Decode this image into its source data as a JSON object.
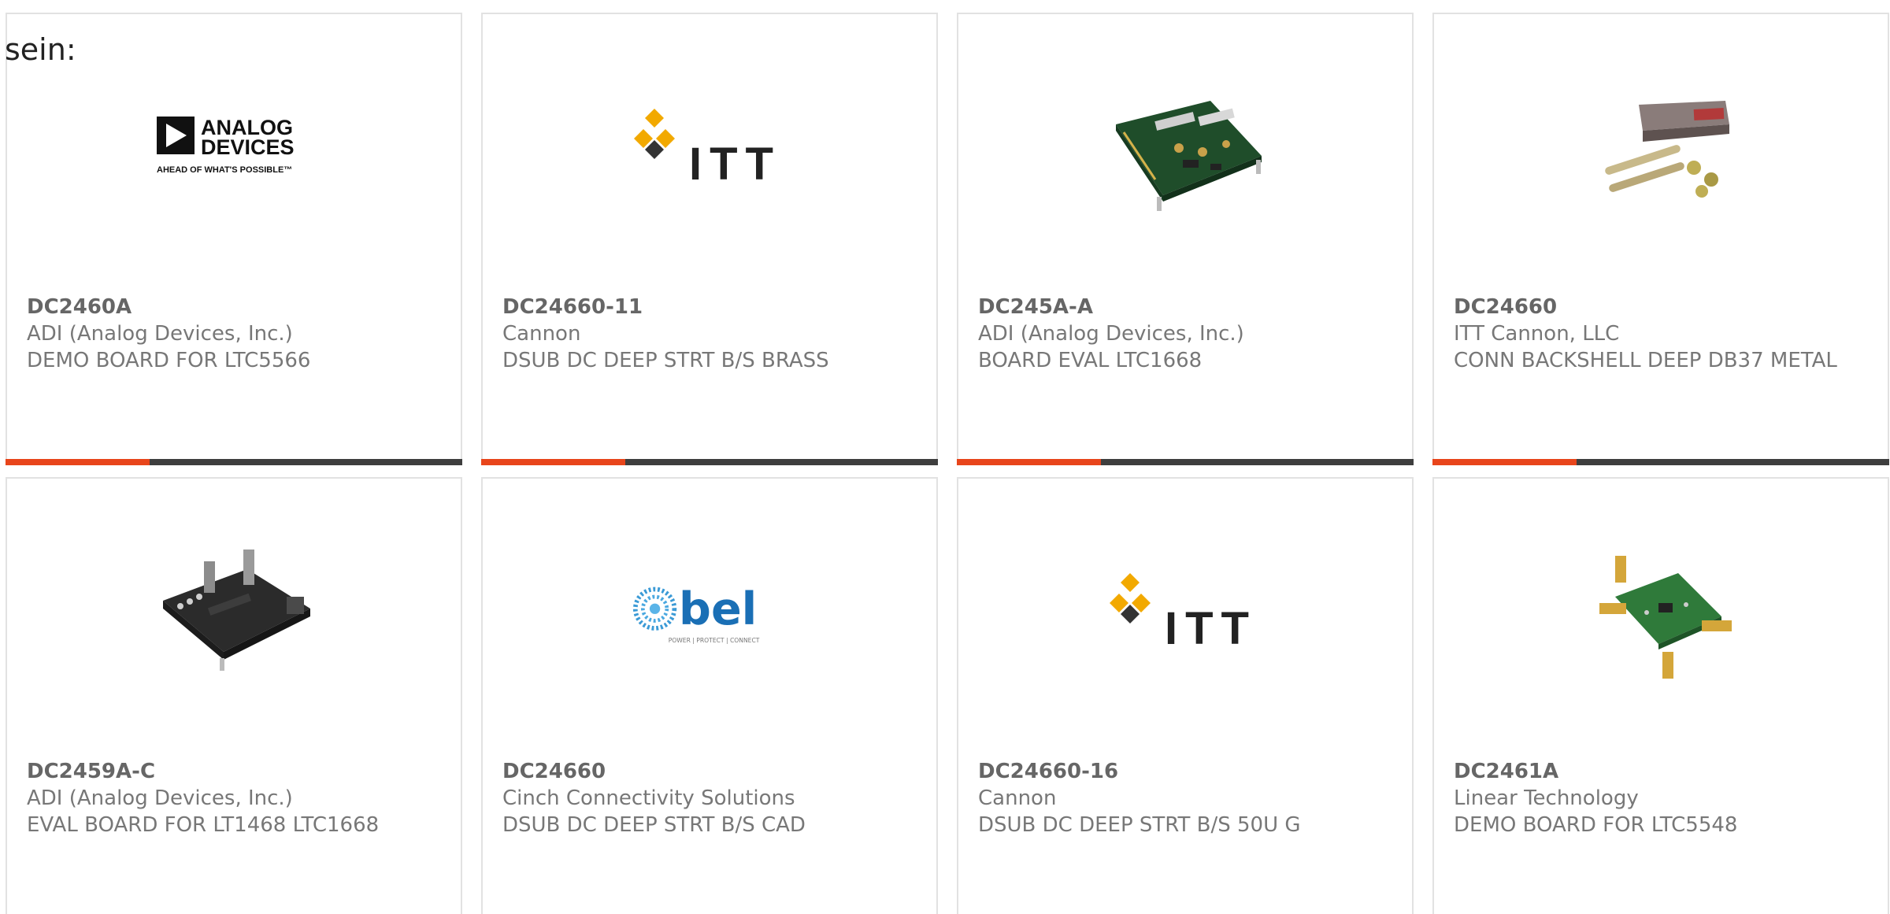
{
  "intro_text": "sein:",
  "colors": {
    "card_border": "#e2e2e2",
    "bar_dark": "#3e3e3e",
    "bar_accent": "#e8451b",
    "text_gray": "#777777"
  },
  "products": [
    {
      "part_number": "DC2460A",
      "manufacturer": "ADI (Analog Devices, Inc.)",
      "description": "DEMO BOARD FOR LTC5566",
      "image": "analog-devices-logo",
      "logo_text": [
        "ANALOG",
        "DEVICES",
        "AHEAD OF WHAT'S POSSIBLE™"
      ]
    },
    {
      "part_number": "DC24660-11",
      "manufacturer": "Cannon",
      "description": "DSUB DC DEEP STRT B/S BRASS",
      "image": "itt-logo",
      "logo_text": [
        "ITT"
      ]
    },
    {
      "part_number": "DC245A-A",
      "manufacturer": "ADI (Analog Devices, Inc.)",
      "description": "BOARD EVAL LTC1668",
      "image": "eval-board-photo"
    },
    {
      "part_number": "DC24660",
      "manufacturer": "ITT Cannon, LLC",
      "description": "CONN BACKSHELL DEEP DB37 METAL",
      "image": "backshell-photo"
    },
    {
      "part_number": "DC2459A-C",
      "manufacturer": "ADI (Analog Devices, Inc.)",
      "description": "EVAL BOARD FOR LT1468 LTC1668",
      "image": "dark-eval-board-photo"
    },
    {
      "part_number": "DC24660",
      "manufacturer": "Cinch Connectivity Solutions",
      "description": "DSUB DC DEEP STRT B/S CAD",
      "image": "bel-logo",
      "logo_text": [
        "bel",
        "POWER | PROTECT | CONNECT"
      ]
    },
    {
      "part_number": "DC24660-16",
      "manufacturer": "Cannon",
      "description": "DSUB DC DEEP STRT B/S 50U G",
      "image": "itt-logo",
      "logo_text": [
        "ITT"
      ]
    },
    {
      "part_number": "DC2461A",
      "manufacturer": "Linear Technology",
      "description": "DEMO BOARD FOR LTC5548",
      "image": "rf-demo-board-photo"
    }
  ]
}
